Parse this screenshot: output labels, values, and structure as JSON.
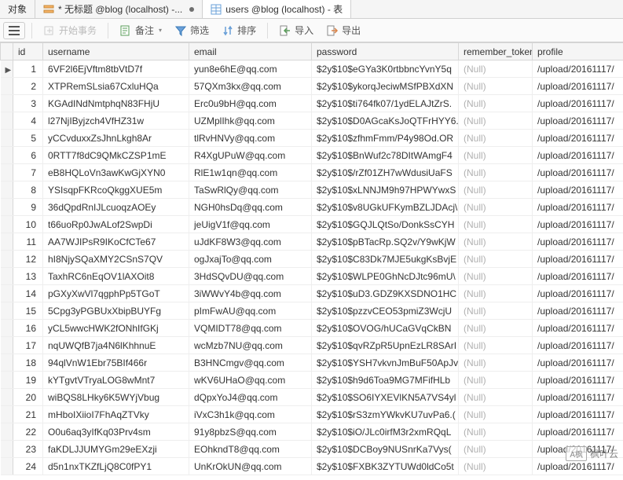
{
  "tabs": {
    "objects": "对象",
    "untitled": "* 无标题 @blog (localhost) -...",
    "users": "users @blog (localhost) - 表"
  },
  "toolbar": {
    "begin_tx": "开始事务",
    "memo": "备注",
    "filter": "筛选",
    "sort": "排序",
    "import": "导入",
    "export": "导出"
  },
  "columns": {
    "id": "id",
    "username": "username",
    "email": "email",
    "password": "password",
    "remember_token": "remember_token",
    "profile": "profile"
  },
  "null_text": "(Null)",
  "watermark": {
    "badge": "A枫",
    "text": "枫叶云"
  },
  "rows": [
    {
      "id": 1,
      "username": "6VF2l6EjVftm8tbVtD7f",
      "email": "yun8e6hE@qq.com",
      "password": "$2y$10$eGYa3K0rtbbncYvnY5q",
      "profile": "/upload/20161117/"
    },
    {
      "id": 2,
      "username": "XTPRemSLsia67CxluHQa",
      "email": "57QXm3kx@qq.com",
      "password": "$2y$10$ykorqJeciwMSfPBXdXN",
      "profile": "/upload/20161117/"
    },
    {
      "id": 3,
      "username": "KGAdINdNmtphqN83FHjU",
      "email": "Erc0u9bH@qq.com",
      "password": "$2y$10$ti764fk07/1ydELAJtZrS.",
      "profile": "/upload/20161117/"
    },
    {
      "id": 4,
      "username": "l27NjIByjzch4VfHZ31w",
      "email": "UZMplIhk@qq.com",
      "password": "$2y$10$D0AGcaKsJoQTFrHYY6.",
      "profile": "/upload/20161117/"
    },
    {
      "id": 5,
      "username": "yCCvduxxZsJhnLkgh8Ar",
      "email": "tlRvHNVy@qq.com",
      "password": "$2y$10$zfhmFmm/P4y98Od.OR",
      "profile": "/upload/20161117/"
    },
    {
      "id": 6,
      "username": "0RTT7f8dC9QMkCZSP1mE",
      "email": "R4XgUPuW@qq.com",
      "password": "$2y$10$BnWuf2c78DItWAmgF4",
      "profile": "/upload/20161117/"
    },
    {
      "id": 7,
      "username": "eB8HQLoVn3awKwGjXYN0",
      "email": "RlE1w1qn@qq.com",
      "password": "$2y$10$/rZf01ZH7wWdusiUaFS",
      "profile": "/upload/20161117/"
    },
    {
      "id": 8,
      "username": "YSIsqpFKRcoQkggXUE5m",
      "email": "TaSwRlQy@qq.com",
      "password": "$2y$10$xLNNJM9h97HPWYwxS",
      "profile": "/upload/20161117/"
    },
    {
      "id": 9,
      "username": "36dQpdRnIJLcuoqzAOEy",
      "email": "NGH0hsDq@qq.com",
      "password": "$2y$10$v8UGkUFKymBZLJDAcj\\",
      "profile": "/upload/20161117/"
    },
    {
      "id": 10,
      "username": "t66uoRp0JwALof2SwpDi",
      "email": "jeUigV1f@qq.com",
      "password": "$2y$10$GQJLQtSo/DonkSsCYH",
      "profile": "/upload/20161117/"
    },
    {
      "id": 11,
      "username": "AA7WJIPsR9IKoCfCTe67",
      "email": "uJdKF8W3@qq.com",
      "password": "$2y$10$pBTacRp.SQ2v/Y9wKjW",
      "profile": "/upload/20161117/"
    },
    {
      "id": 12,
      "username": "hI8NjySQaXMY2CSnS7QV",
      "email": "ogJxajTo@qq.com",
      "password": "$2y$10$C83Dk7MJE5ukgKsBvjE",
      "profile": "/upload/20161117/"
    },
    {
      "id": 13,
      "username": "TaxhRC6nEqOV1lAXOit8",
      "email": "3HdSQvDU@qq.com",
      "password": "$2y$10$WLPE0GhNcDJtc96mU\\",
      "profile": "/upload/20161117/"
    },
    {
      "id": 14,
      "username": "pGXyXwVl7qgphPp5TGoT",
      "email": "3iWWvY4b@qq.com",
      "password": "$2y$10$uD3.GDZ9KXSDNO1HC",
      "profile": "/upload/20161117/"
    },
    {
      "id": 15,
      "username": "5Cpg3yPGBUxXbipBUYFg",
      "email": "pImFwAU@qq.com",
      "password": "$2y$10$pzzvCEO53pmiZ3WcjU",
      "profile": "/upload/20161117/"
    },
    {
      "id": 16,
      "username": "yCL5wwcHWK2fONhIfGKj",
      "email": "VQMIDT78@qq.com",
      "password": "$2y$10$OVOG/hUCaGVqCkBN",
      "profile": "/upload/20161117/"
    },
    {
      "id": 17,
      "username": "nqUWQfB7ja4N6lKhhnuE",
      "email": "wcMzb7NU@qq.com",
      "password": "$2y$10$qvRZpR5UpnEzLR8SArI",
      "profile": "/upload/20161117/"
    },
    {
      "id": 18,
      "username": "94qlVnW1Ebr75BIf466r",
      "email": "B3HNCmgv@qq.com",
      "password": "$2y$10$YSH7vkvnJmBuF50ApJv",
      "profile": "/upload/20161117/"
    },
    {
      "id": 19,
      "username": "kYTgvtVTryaLOG8wMnt7",
      "email": "wKV6UHaO@qq.com",
      "password": "$2y$10$h9d6Toa9MG7MFifHLb",
      "profile": "/upload/20161117/"
    },
    {
      "id": 20,
      "username": "wiBQS8LHky6K5WYjVbug",
      "email": "dQpxYoJ4@qq.com",
      "password": "$2y$10$SO6IYXEVlKN5A7VS4yl",
      "profile": "/upload/20161117/"
    },
    {
      "id": 21,
      "username": "mHboIXiioI7FhAqZTVky",
      "email": "iVxC3h1k@qq.com",
      "password": "$2y$10$rS3zmYWkvKU7uvPa6.(",
      "profile": "/upload/20161117/"
    },
    {
      "id": 22,
      "username": "O0u6aq3yIfKq03Prv4sm",
      "email": "91y8pbzS@qq.com",
      "password": "$2y$10$iO/JLc0irfM3r2xmRQqL",
      "profile": "/upload/20161117/"
    },
    {
      "id": 23,
      "username": "faKDLJJUMYGm29eEXzji",
      "email": "EOhkndT8@qq.com",
      "password": "$2y$10$DCBoy9NUSnrKa7Vys(",
      "profile": "/upload/20161117/"
    },
    {
      "id": 24,
      "username": "d5n1nxTKZfLjQ8C0fPY1",
      "email": "UnKrOkUN@qq.com",
      "password": "$2y$10$FXBK3ZYTUWd0ldCo5t",
      "profile": "/upload/20161117/"
    }
  ]
}
